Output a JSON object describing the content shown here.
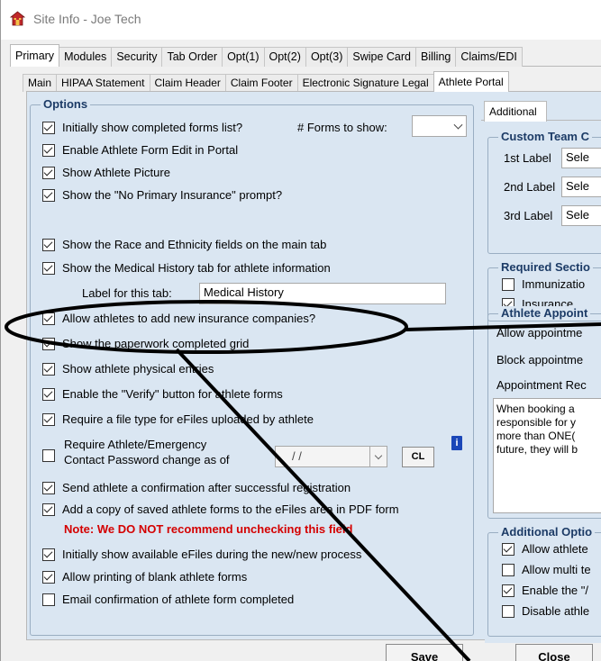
{
  "window": {
    "title": "Site Info - Joe Tech"
  },
  "primary_tabs": [
    "Primary",
    "Modules",
    "Security",
    "Tab Order",
    "Opt(1)",
    "Opt(2)",
    "Opt(3)",
    "Swipe Card",
    "Billing",
    "Claims/EDI"
  ],
  "secondary_tabs": [
    "Main",
    "HIPAA Statement",
    "Claim Header",
    "Claim Footer",
    "Electronic Signature Legal",
    "Athlete Portal"
  ],
  "options": {
    "group_title": "Options",
    "initially_show_completed": {
      "label": "Initially show completed forms list?",
      "checked": true
    },
    "forms_to_show_label": "# Forms to show:",
    "forms_to_show_value": "",
    "enable_athlete_form_edit": {
      "label": "Enable Athlete Form Edit in Portal",
      "checked": true
    },
    "show_athlete_picture": {
      "label": "Show Athlete Picture",
      "checked": true
    },
    "show_no_primary_insurance": {
      "label": "Show the \"No Primary Insurance\" prompt?",
      "checked": true
    },
    "show_race_ethnicity": {
      "label": "Show the Race and Ethnicity fields on the main tab",
      "checked": true
    },
    "show_medical_history": {
      "label": "Show the Medical History tab for athlete information",
      "checked": true
    },
    "label_for_tab_label": "Label for this tab:",
    "label_for_tab_value": "Medical History",
    "allow_add_insurance": {
      "label": "Allow athletes to add new insurance companies?",
      "checked": true
    },
    "show_paperwork_grid": {
      "label": "Show the paperwork completed grid",
      "checked": true
    },
    "show_physical_entries": {
      "label": "Show athlete physical entries",
      "checked": true
    },
    "enable_verify_button": {
      "label": "Enable the \"Verify\" button for athlete forms",
      "checked": true
    },
    "require_file_type": {
      "label": "Require a file type for eFiles uploaded by athlete",
      "checked": true
    },
    "require_password_change": {
      "label_line1": "Require Athlete/Emergency",
      "label_line2": "Contact Password change as of",
      "checked": false
    },
    "password_date_value": "/     /",
    "cl_button": "CL",
    "send_confirmation": {
      "label": "Send athlete a confirmation after successful registration",
      "checked": true
    },
    "add_copy_saved_forms": {
      "label": "Add a copy of saved athlete forms to the eFiles area in PDF form",
      "checked": true
    },
    "note": "Note:  We DO NOT recommend unchecking this field",
    "initially_show_efiles": {
      "label": "Initially show available eFiles during the new/new process",
      "checked": true
    },
    "allow_printing_blank": {
      "label": "Allow printing of blank athlete forms",
      "checked": true
    },
    "email_confirmation": {
      "label": "Email confirmation of athlete form completed",
      "checked": false
    }
  },
  "right_panel": {
    "tab": "Additional",
    "custom_team_title": "Custom Team C",
    "label1": "1st Label",
    "label2": "2nd Label",
    "label3": "3rd Label",
    "select_placeholder": "Sele",
    "required_sections_title": "Required Sectio",
    "immunization": {
      "label": "Immunizatio",
      "checked": false
    },
    "insurance": {
      "label": "Insurance",
      "checked": true
    },
    "athlete_appt_title": "Athlete Appoint",
    "allow_appt": "Allow appointme",
    "block_appt": "Block appointme",
    "appt_req": "Appointment Rec",
    "appt_text": [
      "When booking a",
      "responsible for y",
      "more than ONE(",
      "future, they will b"
    ],
    "additional_options_title": "Additional Optio",
    "allow_athlete": {
      "label": "Allow athlete",
      "checked": true
    },
    "allow_multi": {
      "label": "Allow multi te",
      "checked": false
    },
    "enable_the": {
      "label": "Enable the \"/",
      "checked": true
    },
    "disable_athl": {
      "label": "Disable athle",
      "checked": false
    }
  },
  "buttons": {
    "save": "Save",
    "close": "Close"
  },
  "colors": {
    "panel_bg": "#dae6f2",
    "group_title": "#1c3b66",
    "note": "#d40000"
  }
}
